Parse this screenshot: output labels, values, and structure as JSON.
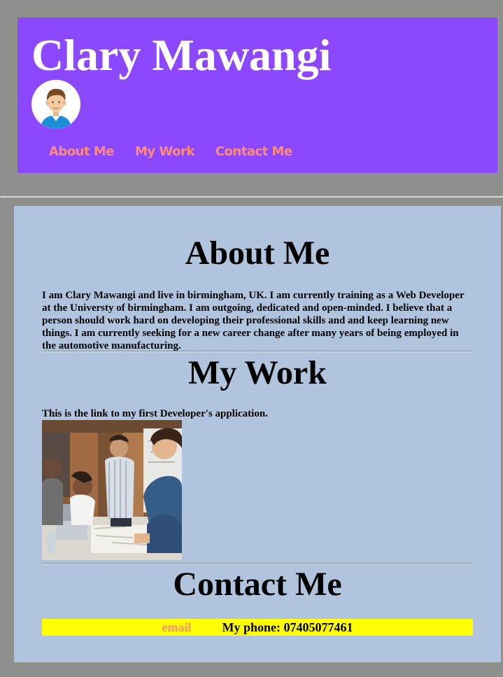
{
  "header": {
    "title": "Clary Mawangi",
    "avatar_icon": "user-avatar-icon",
    "nav": [
      {
        "label": "About Me"
      },
      {
        "label": "My Work"
      },
      {
        "label": "Contact Me"
      }
    ]
  },
  "about": {
    "heading": "About Me",
    "text": "I am Clary Mawangi and live in birmingham, UK. I am currently training as a Web Developer at the Universty of birmingham. I am outgoing, dedicated and open-minded. I believe that a person should work hard on developing their professional skills and and keep learning new things. I am currently seeking for a new career change after many years of being employed in the automotive manufacturing."
  },
  "work": {
    "heading": "My Work",
    "text": "This is the link to my first Developer's application."
  },
  "contact": {
    "heading": "Contact Me",
    "email_label": "email",
    "phone_text": "My phone: 07405077461"
  },
  "colors": {
    "page_background": "#8f908d",
    "header_background": "#8b48ff",
    "nav_link": "#ff8c7a",
    "main_background": "#b0c4de",
    "contact_bar": "#ffff00"
  }
}
